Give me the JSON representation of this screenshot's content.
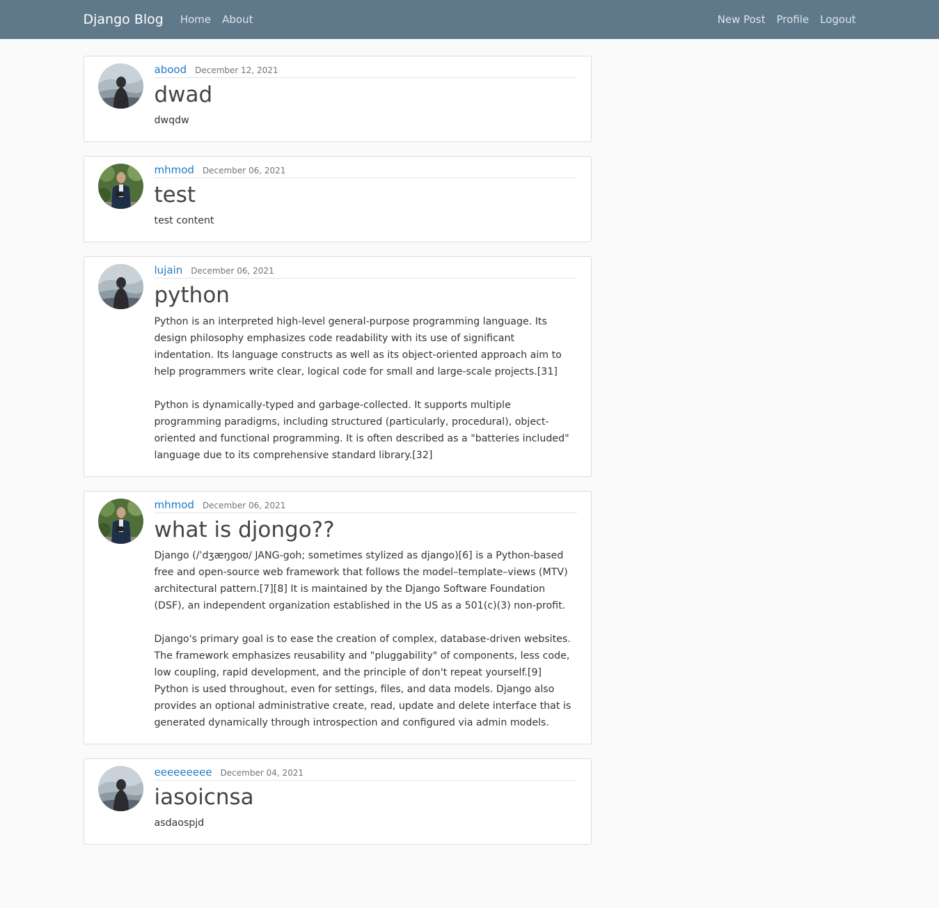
{
  "navbar": {
    "brand": "Django Blog",
    "links_left": [
      "Home",
      "About"
    ],
    "links_right": [
      "New Post",
      "Profile",
      "Logout"
    ]
  },
  "posts": [
    {
      "author": "abood",
      "date": "December 12, 2021",
      "title": "dwad",
      "avatar_icon": "default-avatar-icon",
      "paragraphs": [
        "dwqdw"
      ]
    },
    {
      "author": "mhmod",
      "date": "December 06, 2021",
      "title": "test",
      "avatar_icon": "user-photo-avatar",
      "paragraphs": [
        "test content"
      ]
    },
    {
      "author": "lujain",
      "date": "December 06, 2021",
      "title": "python",
      "avatar_icon": "default-avatar-icon",
      "paragraphs": [
        "Python is an interpreted high-level general-purpose programming language. Its design philosophy emphasizes code readability with its use of significant indentation. Its language constructs as well as its object-oriented approach aim to help programmers write clear, logical code for small and large-scale projects.[31]",
        "Python is dynamically-typed and garbage-collected. It supports multiple programming paradigms, including structured (particularly, procedural), object-oriented and functional programming. It is often described as a \"batteries included\" language due to its comprehensive standard library.[32]"
      ]
    },
    {
      "author": "mhmod",
      "date": "December 06, 2021",
      "title": "what is djongo??",
      "avatar_icon": "user-photo-avatar",
      "paragraphs": [
        "Django (/ˈdʒæŋɡoʊ/ JANG-goh; sometimes stylized as django)[6] is a Python-based free and open-source web framework that follows the model–template–views (MTV) architectural pattern.[7][8] It is maintained by the Django Software Foundation (DSF), an independent organization established in the US as a 501(c)(3) non-profit.",
        "Django's primary goal is to ease the creation of complex, database-driven websites. The framework emphasizes reusability and \"pluggability\" of components, less code, low coupling, rapid development, and the principle of don't repeat yourself.[9] Python is used throughout, even for settings, files, and data models. Django also provides an optional administrative create, read, update and delete interface that is generated dynamically through introspection and configured via admin models."
      ]
    },
    {
      "author": "eeeeeeeee",
      "date": "December 04, 2021",
      "title": "iasoicnsa",
      "avatar_icon": "default-avatar-icon",
      "paragraphs": [
        "asdaospjd"
      ]
    }
  ],
  "colors": {
    "navbar": "#5f788a",
    "link": "#1e79c9",
    "background": "#fafafa"
  }
}
